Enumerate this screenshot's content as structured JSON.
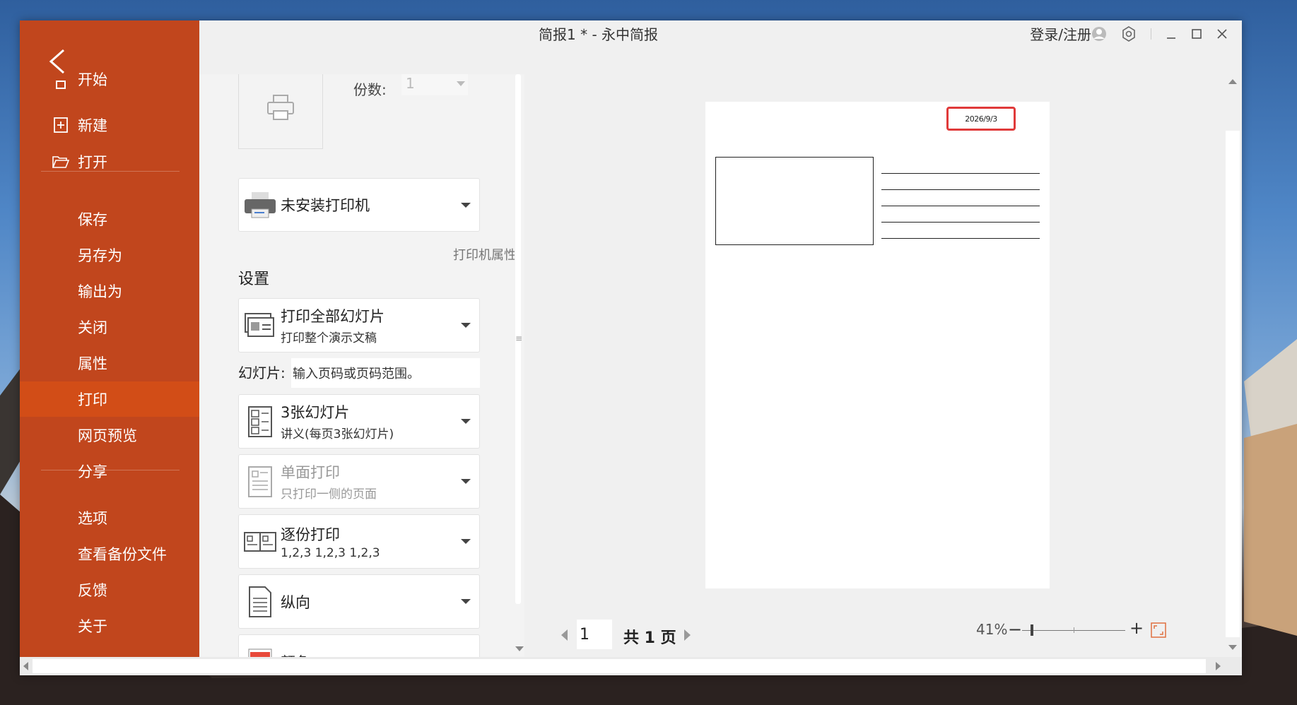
{
  "window": {
    "title": "简报1 * - 永中简报",
    "login_label": "登录/注册"
  },
  "sidebar": {
    "items": [
      {
        "label": "开始",
        "icon": "home-icon"
      },
      {
        "label": "新建",
        "icon": "new-doc-icon"
      },
      {
        "label": "打开",
        "icon": "folder-open-icon"
      },
      {
        "label": "保存"
      },
      {
        "label": "另存为"
      },
      {
        "label": "输出为"
      },
      {
        "label": "关闭"
      },
      {
        "label": "属性"
      },
      {
        "label": "打印",
        "active": true
      },
      {
        "label": "网页预览"
      },
      {
        "label": "分享"
      },
      {
        "label": "选项"
      },
      {
        "label": "查看备份文件"
      },
      {
        "label": "反馈"
      },
      {
        "label": "关于"
      }
    ]
  },
  "print_panel": {
    "copies_label": "份数:",
    "copies_value": "1",
    "printer": "未安装打印机",
    "printer_properties": "打印机属性",
    "settings_heading": "设置",
    "range": {
      "title": "打印全部幻灯片",
      "subtitle": "打印整个演示文稿"
    },
    "slides_label": "幻灯片:",
    "slides_placeholder": "输入页码或页码范围。",
    "layout": {
      "title": "3张幻灯片",
      "subtitle": "讲义(每页3张幻灯片)"
    },
    "sides": {
      "title": "单面打印",
      "subtitle": "只打印一侧的页面"
    },
    "collate": {
      "title": "逐份打印",
      "subtitle": "1,2,3 1,2,3 1,2,3"
    },
    "orientation": {
      "title": "纵向"
    },
    "color": {
      "title": "颜色"
    }
  },
  "preview": {
    "date": "2026/9/3",
    "current_page": "1",
    "total_pages": "共 1 页",
    "zoom": "41%",
    "zoom_fraction": 0.41
  },
  "colors": {
    "sidebar_bg": "#c1461d",
    "sidebar_active": "#d24d17",
    "highlight_border": "#e03a3a"
  }
}
